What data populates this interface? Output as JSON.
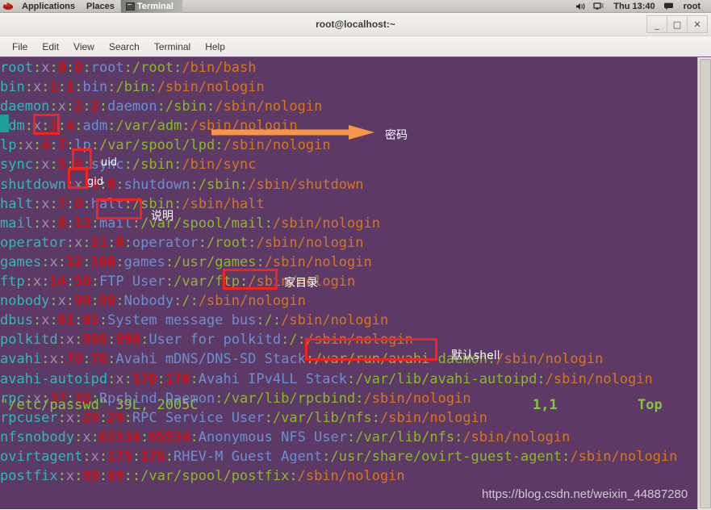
{
  "panel": {
    "logo_icon": "redhat-logo-icon",
    "applications": "Applications",
    "places": "Places",
    "terminal_task": "Terminal",
    "volume_icon": "volume-icon",
    "network_icon": "network-icon",
    "clock": "Thu 13:40",
    "user_icon": "user-status-icon",
    "user": "root"
  },
  "window": {
    "title": "root@localhost:~",
    "minimize": "_",
    "maximize": "□",
    "close": "✕"
  },
  "menu": {
    "items": [
      "File",
      "Edit",
      "View",
      "Search",
      "Terminal",
      "Help"
    ]
  },
  "terminal": {
    "colors": {
      "background": "#5d3a66",
      "username": "#2fb8b8",
      "password_x": "#9b8fa3",
      "uid_gid": "#cc1111",
      "separator": "#86c442",
      "comment": "#6a8fd0",
      "home": "#8ab82a",
      "shell": "#d4761f",
      "cursor": "#1f9e9e",
      "annotation_box": "#f4231f",
      "annotation_arrow": "#f79646"
    },
    "lines": [
      {
        "user": "root",
        "x": "x",
        "uid": "0",
        "gid": "0",
        "comment": "root",
        "home": "/root",
        "shell": "/bin/bash"
      },
      {
        "user": "bin",
        "x": "x",
        "uid": "1",
        "gid": "1",
        "comment": "bin",
        "home": "/bin",
        "shell": "/sbin/nologin"
      },
      {
        "user": "daemon",
        "x": "x",
        "uid": "2",
        "gid": "2",
        "comment": "daemon",
        "home": "/sbin",
        "shell": "/sbin/nologin"
      },
      {
        "user": "adm",
        "x": "x",
        "uid": "3",
        "gid": "4",
        "comment": "adm",
        "home": "/var/adm",
        "shell": "/sbin/nologin"
      },
      {
        "user": "lp",
        "x": "x",
        "uid": "4",
        "gid": "7",
        "comment": "lp",
        "home": "/var/spool/lpd",
        "shell": "/sbin/nologin"
      },
      {
        "user": "sync",
        "x": "x",
        "uid": "5",
        "gid": "0",
        "comment": "sync",
        "home": "/sbin",
        "shell": "/bin/sync"
      },
      {
        "user": "shutdown",
        "x": "x",
        "uid": "6",
        "gid": "0",
        "comment": "shutdown",
        "home": "/sbin",
        "shell": "/sbin/shutdown"
      },
      {
        "user": "halt",
        "x": "x",
        "uid": "7",
        "gid": "0",
        "comment": "halt",
        "home": "/sbin",
        "shell": "/sbin/halt"
      },
      {
        "user": "mail",
        "x": "x",
        "uid": "8",
        "gid": "12",
        "comment": "mail",
        "home": "/var/spool/mail",
        "shell": "/sbin/nologin"
      },
      {
        "user": "operator",
        "x": "x",
        "uid": "11",
        "gid": "0",
        "comment": "operator",
        "home": "/root",
        "shell": "/sbin/nologin"
      },
      {
        "user": "games",
        "x": "x",
        "uid": "12",
        "gid": "100",
        "comment": "games",
        "home": "/usr/games",
        "shell": "/sbin/nologin"
      },
      {
        "user": "ftp",
        "x": "x",
        "uid": "14",
        "gid": "50",
        "comment": "FTP User",
        "home": "/var/ftp",
        "shell": "/sbin/nologin"
      },
      {
        "user": "nobody",
        "x": "x",
        "uid": "99",
        "gid": "99",
        "comment": "Nobody",
        "home": "/",
        "shell": "/sbin/nologin"
      },
      {
        "user": "dbus",
        "x": "x",
        "uid": "81",
        "gid": "81",
        "comment": "System message bus",
        "home": "/",
        "shell": "/sbin/nologin"
      },
      {
        "user": "polkitd",
        "x": "x",
        "uid": "999",
        "gid": "998",
        "comment": "User for polkitd",
        "home": "/",
        "shell": "/sbin/nologin"
      },
      {
        "user": "avahi",
        "x": "x",
        "uid": "70",
        "gid": "70",
        "comment": "Avahi mDNS/DNS-SD Stack",
        "home": "/var/run/avahi-daemon",
        "shell": "/sbin/nologin"
      },
      {
        "user": "avahi-autoipd",
        "x": "x",
        "uid": "170",
        "gid": "170",
        "comment": "Avahi IPv4LL Stack",
        "home": "/var/lib/avahi-autoipd",
        "shell": "/sbin/nologin"
      },
      {
        "user": "rpc",
        "x": "x",
        "uid": "32",
        "gid": "32",
        "comment": "Rpcbind Daemon",
        "home": "/var/lib/rpcbind",
        "shell": "/sbin/nologin"
      },
      {
        "user": "rpcuser",
        "x": "x",
        "uid": "29",
        "gid": "29",
        "comment": "RPC Service User",
        "home": "/var/lib/nfs",
        "shell": "/sbin/nologin"
      },
      {
        "user": "nfsnobody",
        "x": "x",
        "uid": "65534",
        "gid": "65534",
        "comment": "Anonymous NFS User",
        "home": "/var/lib/nfs",
        "shell": "/sbin/nologin"
      },
      {
        "user": "ovirtagent",
        "x": "x",
        "uid": "175",
        "gid": "175",
        "comment": "RHEV-M Guest Agent",
        "home": "/usr/share/ovirt-guest-agent",
        "shell": "/sbin/nologin"
      },
      {
        "user": "postfix",
        "x": "x",
        "uid": "89",
        "gid": "89",
        "comment": "",
        "home": "/var/spool/postfix",
        "shell": "/sbin/nologin"
      }
    ],
    "status": {
      "file": "\"/etc/passwd\" 39L, 2005C",
      "position": "1,1",
      "scroll": "Top"
    }
  },
  "annotations": [
    {
      "name": "password-field-box",
      "label": "密码"
    },
    {
      "name": "uid-field-box",
      "label": "uid"
    },
    {
      "name": "gid-field-box",
      "label": "gid"
    },
    {
      "name": "comment-field-box",
      "label": "说明"
    },
    {
      "name": "home-field-box",
      "label": "家目录"
    },
    {
      "name": "shell-field-box",
      "label": "默认shell"
    }
  ],
  "watermark": "https://blog.csdn.net/weixin_44887280"
}
